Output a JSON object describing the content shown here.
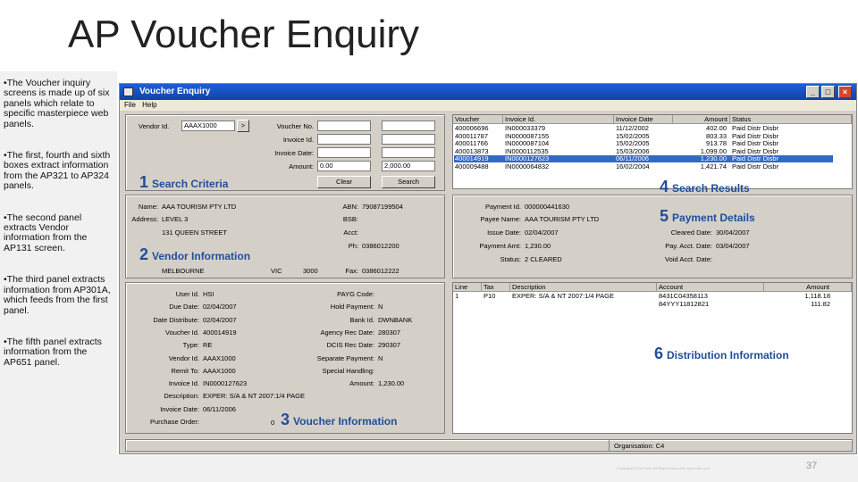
{
  "slide": {
    "title": "AP Voucher Enquiry",
    "bullets": [
      "•The Voucher inquiry screens is made up of six panels which relate to specific masterpiece web panels.",
      "•The first, fourth and sixth boxes extract information from the AP321 to AP324 panels.",
      "•The second panel extracts Vendor information from the AP131 screen.",
      "•The third panel extracts information from AP301A, which feeds from the first panel.",
      "•The fifth panel extracts information from the AP651 panel."
    ],
    "page_number": "37",
    "copyright": "Copyright© 2012 Infor. All Rights Reserved. www.infor.com"
  },
  "window": {
    "title": "Voucher Enquiry",
    "menu": [
      "File",
      "Help"
    ],
    "controls": [
      "_",
      "□",
      "×"
    ]
  },
  "search_criteria": {
    "vendor_id_label": "Vendor Id.",
    "vendor_id_value": "AAAX1000",
    "lookup_label": ">",
    "voucher_no_label": "Voucher No.",
    "invoice_id_label": "Invoice Id.",
    "invoice_date_label": "Invoice Date:",
    "amount_label": "Amount:",
    "amount_from": "0.00",
    "amount_to": "2,000.00",
    "clear_label": "Clear",
    "search_label": "Search"
  },
  "search_results": {
    "headers": [
      "Voucher",
      "Invoice Id.",
      "Invoice Date",
      "Amount",
      "Status"
    ],
    "rows": [
      [
        "400006696",
        "IN000033379",
        "11/12/2002",
        "402.00",
        "Paid  Distr  Disbr"
      ],
      [
        "400011787",
        "IN0000087155",
        "15/02/2005",
        "803.33",
        "Paid  Distr  Disbr"
      ],
      [
        "400011766",
        "IN0000087104",
        "15/02/2005",
        "913.78",
        "Paid  Distr  Disbr"
      ],
      [
        "400013873",
        "IN0000112535",
        "15/03/2006",
        "1,099.00",
        "Paid  Distr  Disbr"
      ],
      [
        "400014919",
        "IN0000127623",
        "06/11/2006",
        "1,230.00",
        "Paid  Distr  Disbr"
      ],
      [
        "400009488",
        "IN0000064832",
        "16/02/2004",
        "1,421.74",
        "Paid  Distr  Disbr"
      ]
    ]
  },
  "vendor_info": {
    "name_label": "Name:",
    "name": "AAA TOURISM PTY LTD",
    "address_label": "Address:",
    "address1": "LEVEL 3",
    "address2": "131 QUEEN STREET",
    "city": "MELBOURNE",
    "state": "VIC",
    "postcode": "3000",
    "abn_label": "ABN:",
    "abn": "79087199504",
    "bsb_label": "BSB:",
    "acct_label": "Acct:",
    "ph_label": "Ph:",
    "ph": "0386012200",
    "fax_label": "Fax:",
    "fax": "0386012222"
  },
  "payment_details": {
    "payment_id_label": "Payment Id.",
    "payment_id": "000000441630",
    "payee_name_label": "Payee Name:",
    "payee_name": "AAA TOURISM PTY LTD",
    "issue_date_label": "Issue Date:",
    "issue_date": "02/04/2007",
    "cleared_date_label": "Cleared Date:",
    "cleared_date": "30/04/2007",
    "payment_amt_label": "Payment Amt:",
    "payment_amt": "1,230.00",
    "pay_acct_date_label": "Pay. Acct. Date:",
    "pay_acct_date": "03/04/2007",
    "status_label": "Status:",
    "status": "2 CLEARED",
    "void_acct_date_label": "Void Acct. Date:"
  },
  "voucher_info": {
    "left": [
      {
        "label": "User Id.",
        "value": "HSI"
      },
      {
        "label": "Due Date:",
        "value": "02/04/2007"
      },
      {
        "label": "Date Distribute:",
        "value": "02/04/2007"
      },
      {
        "label": "Voucher Id.",
        "value": "400014919"
      },
      {
        "label": "Type:",
        "value": "RE"
      },
      {
        "label": "Vendor Id.",
        "value": "AAAX1000"
      },
      {
        "label": "Remit To:",
        "value": "AAAX1000"
      },
      {
        "label": "Invoice Id.",
        "value": "IN0000127623"
      },
      {
        "label": "Description:",
        "value": "EXPER: S/A & NT 2007:1/4 PAGE"
      },
      {
        "label": "Invoice Date:",
        "value": "06/11/2006"
      },
      {
        "label": "Purchase Order:",
        "value": ""
      }
    ],
    "right": [
      {
        "label": "PAYG Code:",
        "value": ""
      },
      {
        "label": "Hold Payment:",
        "value": "N"
      },
      {
        "label": "Bank Id.",
        "value": "DWNBANK"
      },
      {
        "label": "Agency Rec Date:",
        "value": "280307"
      },
      {
        "label": "DCIS Rec Date:",
        "value": "290307"
      },
      {
        "label": "Separate Payment:",
        "value": "N"
      },
      {
        "label": "Special Handling:",
        "value": ""
      },
      {
        "label": "Amount:",
        "value": "1,230.00"
      }
    ],
    "po_value": "0"
  },
  "distribution": {
    "headers": [
      "Line",
      "Tax",
      "Description",
      "Account",
      "Amount"
    ],
    "rows": [
      [
        "1",
        "P10",
        "EXPER: S/A & NT 2007:1/4 PAGE",
        "8431C04358113",
        "1,118.18"
      ],
      [
        "",
        "",
        "",
        "84YYY11812821",
        "111.82"
      ]
    ]
  },
  "organisation_label": "Organisation: C4",
  "panel_labels": [
    {
      "num": "1",
      "text": "Search Criteria"
    },
    {
      "num": "2",
      "text": "Vendor Information"
    },
    {
      "num": "3",
      "text": "Voucher Information"
    },
    {
      "num": "4",
      "text": "Search Results"
    },
    {
      "num": "5",
      "text": "Payment Details"
    },
    {
      "num": "6",
      "text": "Distribution Information"
    }
  ],
  "colors": {
    "title_bar": "#1d5fd6",
    "label_blue": "#1f4e9a",
    "selection": "#316ac5"
  }
}
